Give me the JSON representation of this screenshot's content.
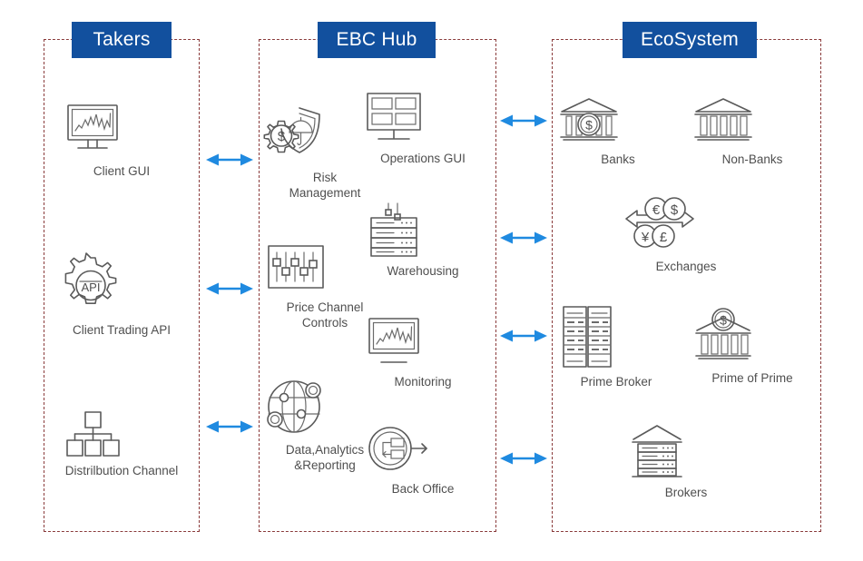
{
  "diagram": {
    "title_color": "#12509e",
    "border_color": "#8a3b3b",
    "arrow_color": "#1f8ae0",
    "icon_color": "#5a5a5a"
  },
  "panels": [
    {
      "id": "takers",
      "title": "Takers",
      "nodes": [
        {
          "label": "Client GUI",
          "icon": "monitor-chart-icon"
        },
        {
          "label": "Client Trading API",
          "icon": "gear-api-icon"
        },
        {
          "label": "Distrilbution Channel",
          "icon": "hierarchy-icon"
        }
      ]
    },
    {
      "id": "ebc-hub",
      "title": "EBC Hub",
      "nodes": [
        {
          "label": "Risk\nManagement",
          "icon": "shield-umbrella-dollar-icon"
        },
        {
          "label": "Operations GUI",
          "icon": "monitor-panes-icon"
        },
        {
          "label": "Price Channel\nControls",
          "icon": "sliders-icon"
        },
        {
          "label": "Warehousing",
          "icon": "server-rack-icon"
        },
        {
          "label": "Monitoring",
          "icon": "monitor-chart-icon"
        },
        {
          "label": "Data,Analytics\n&Reporting",
          "icon": "globe-network-icon"
        },
        {
          "label": "Back Office",
          "icon": "workflow-circle-arrow-icon"
        }
      ]
    },
    {
      "id": "ecosystem",
      "title": "EcoSystem",
      "nodes": [
        {
          "label": "Banks",
          "icon": "bank-dollar-icon"
        },
        {
          "label": "Non-Banks",
          "icon": "bank-columns-icon"
        },
        {
          "label": "Exchanges",
          "icon": "currency-exchange-icon"
        },
        {
          "label": "Prime Broker",
          "icon": "server-towers-icon"
        },
        {
          "label": "Prime of Prime",
          "icon": "bank-dollar-roof-icon"
        },
        {
          "label": "Brokers",
          "icon": "building-roof-icon"
        }
      ]
    }
  ],
  "connectors": {
    "left_group": "takers-to-hub",
    "right_group": "hub-to-ecosystem",
    "left_count": 3,
    "right_count": 4,
    "style": "double-headed-arrow"
  }
}
